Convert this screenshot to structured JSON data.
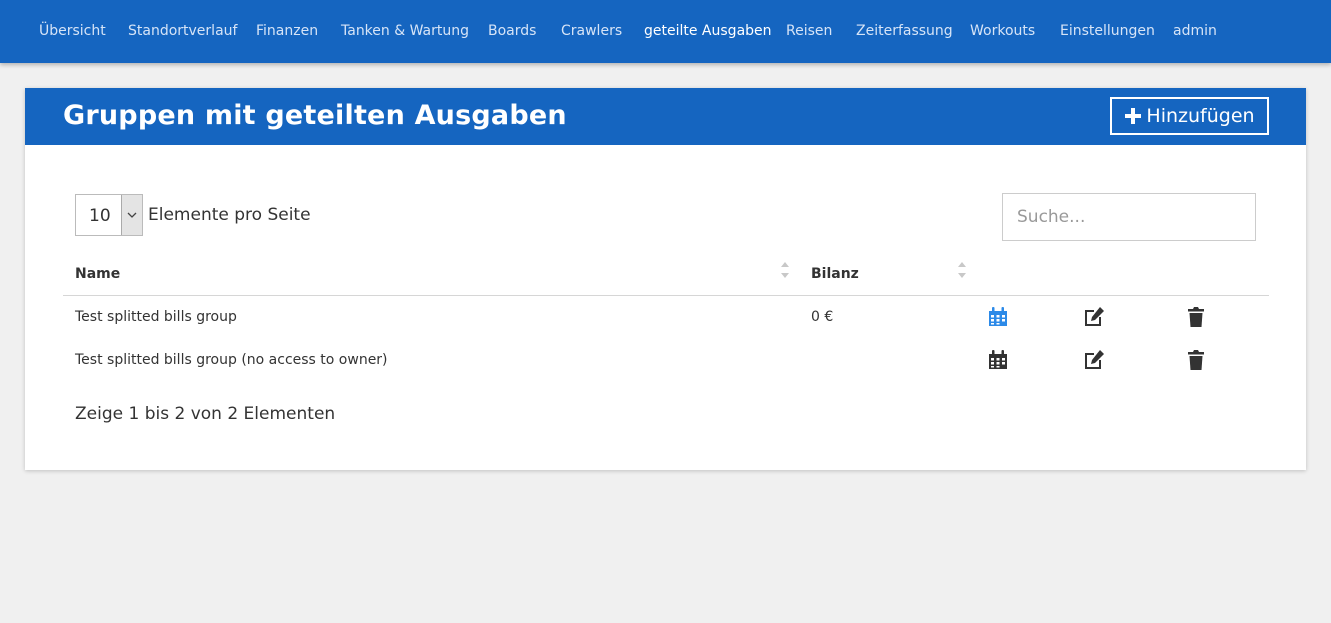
{
  "nav": {
    "items": [
      {
        "label": "Übersicht"
      },
      {
        "label": "Standortverlauf"
      },
      {
        "label": "Finanzen"
      },
      {
        "label": "Tanken & Wartung"
      },
      {
        "label": "Boards"
      },
      {
        "label": "Crawlers"
      },
      {
        "label": "geteilte Ausgaben",
        "active": true
      },
      {
        "label": "Reisen"
      },
      {
        "label": "Zeiterfassung"
      },
      {
        "label": "Workouts"
      },
      {
        "label": "Einstellungen"
      },
      {
        "label": "admin"
      }
    ]
  },
  "card": {
    "title": "Gruppen mit geteilten Ausgaben",
    "add_label": "Hinzufügen",
    "add_icon": "plus-icon"
  },
  "table_controls": {
    "page_size": "10",
    "per_page_label": "Elemente pro Seite",
    "search_placeholder": "Suche..."
  },
  "table": {
    "columns": [
      "Name",
      "Bilanz"
    ],
    "rows": [
      {
        "name": "Test splitted bills group",
        "balance": "0 €",
        "calendar_color": "#2c8ae8"
      },
      {
        "name": "Test splitted bills group (no access to owner)",
        "balance": "",
        "calendar_color": "#333333"
      }
    ],
    "action_icons": [
      "calendar-icon",
      "edit-icon",
      "trash-icon"
    ]
  },
  "footer": {
    "info": "Zeige 1 bis 2 von 2 Elementen"
  },
  "colors": {
    "primary": "#1565c0",
    "background": "#f0f0f0",
    "calendar_accent": "#2c8ae8"
  }
}
